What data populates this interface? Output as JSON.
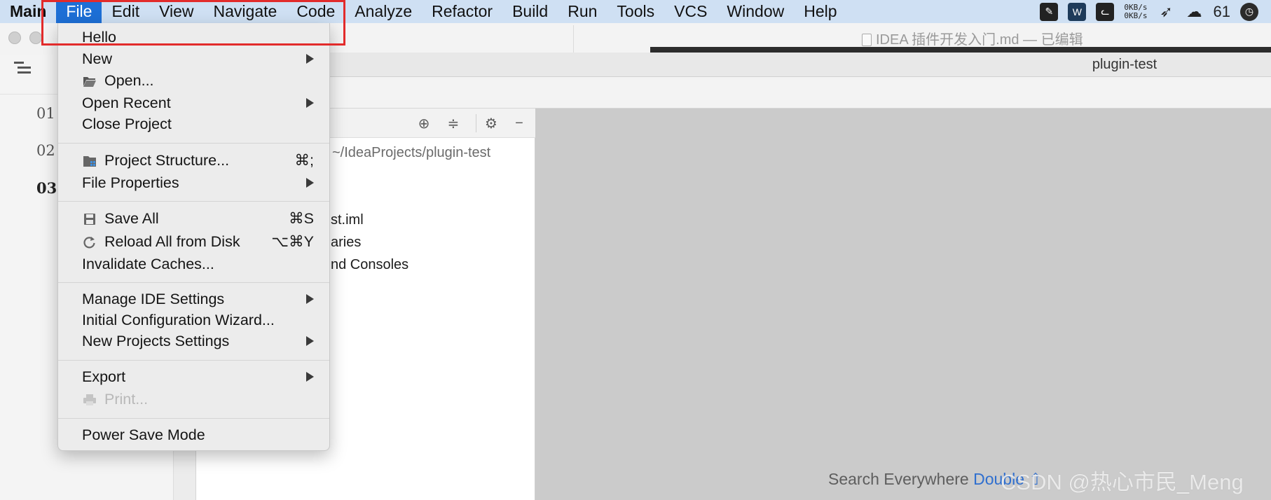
{
  "menubar": {
    "app_name": "Main",
    "items": [
      "File",
      "Edit",
      "View",
      "Navigate",
      "Code",
      "Analyze",
      "Refactor",
      "Build",
      "Run",
      "Tools",
      "VCS",
      "Window",
      "Help"
    ],
    "tray": {
      "net_up": "0KB/s",
      "net_down": "0KB/s",
      "count": "61",
      "icons": [
        "notes-app-icon",
        "wps-icon",
        "cat-app-icon",
        "bird-app-icon",
        "wechat-icon",
        "clock-icon"
      ]
    }
  },
  "typora": {
    "title": "IDEA 插件开发入门.md — 已编辑",
    "outline": [
      "01",
      "02",
      "03"
    ]
  },
  "ide": {
    "project_title": "plugin-test",
    "project_path": "~/IdeaProjects/plugin-test",
    "tree": [
      "st.iml",
      "aries",
      "nd Consoles"
    ],
    "search_hint": "Search Everywhere",
    "search_shortcut": "Double ⇧"
  },
  "watermark": "CSDN @热心市民_Meng",
  "file_menu": {
    "items": [
      {
        "label": "Hello"
      },
      {
        "label": "New",
        "submenu": true
      },
      {
        "label": "Open...",
        "icon": "folder-open-icon"
      },
      {
        "label": "Open Recent",
        "submenu": true
      },
      {
        "label": "Close Project"
      },
      {
        "label": "Project Structure...",
        "icon": "project-structure-icon",
        "shortcut": "⌘;"
      },
      {
        "label": "File Properties",
        "submenu": true
      },
      {
        "label": "Save All",
        "icon": "save-icon",
        "shortcut": "⌘S"
      },
      {
        "label": "Reload All from Disk",
        "icon": "reload-icon",
        "shortcut": "⌥⌘Y"
      },
      {
        "label": "Invalidate Caches..."
      },
      {
        "label": "Manage IDE Settings",
        "submenu": true
      },
      {
        "label": "Initial Configuration Wizard..."
      },
      {
        "label": "New Projects Settings",
        "submenu": true
      },
      {
        "label": "Export",
        "submenu": true
      },
      {
        "label": "Print...",
        "icon": "print-icon",
        "disabled": true
      },
      {
        "label": "Power Save Mode"
      }
    ]
  },
  "colors": {
    "menubar_bg": "#cfe0f3",
    "active_menu": "#1d6fd6",
    "highlight_box": "#e22b2b",
    "menu_bg": "#ececec",
    "editor_bg": "#cbcbcb",
    "shortcut_blue": "#2f6fcf"
  }
}
